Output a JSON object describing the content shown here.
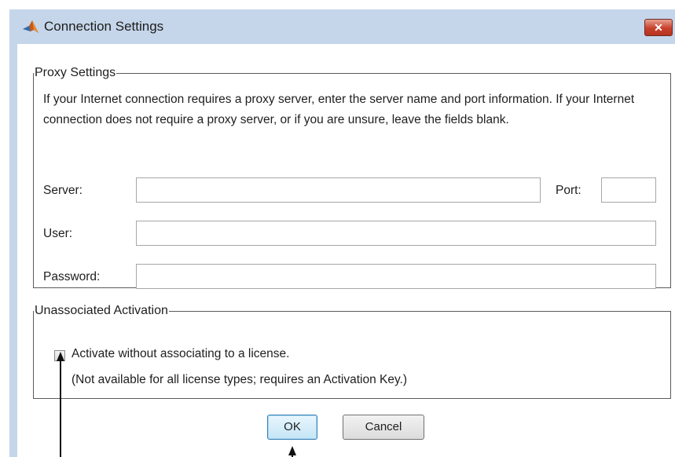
{
  "window": {
    "title": "Connection Settings",
    "close_label": "✕"
  },
  "proxy": {
    "legend": "Proxy Settings",
    "description": "If your Internet connection requires a proxy server, enter the server name and port information. If your Internet connection does not require a proxy server, or if you are unsure, leave the fields blank.",
    "server_label": "Server:",
    "server_value": "",
    "port_label": "Port:",
    "port_value": "",
    "user_label": "User:",
    "user_value": "",
    "password_label": "Password:",
    "password_value": ""
  },
  "unassociated": {
    "legend": "Unassociated Activation",
    "checkbox_label": "Activate without associating to a license.",
    "checkbox_checked": false,
    "note": "(Not available for all license types; requires an Activation Key.)"
  },
  "buttons": {
    "ok": "OK",
    "cancel": "Cancel"
  },
  "colors": {
    "title_bar": "#c5d6ea",
    "close_button": "#c8402c",
    "ok_button": "#c4e5f6"
  }
}
